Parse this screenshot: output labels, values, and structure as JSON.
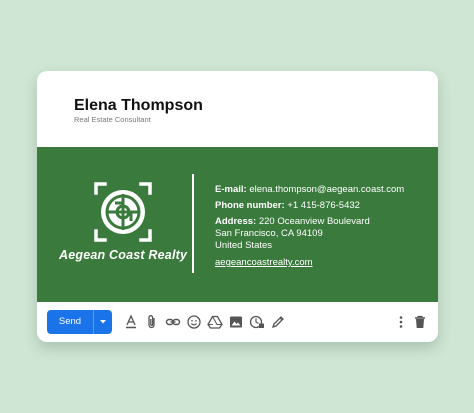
{
  "signature": {
    "name": "Elena Thompson",
    "title": "Real Estate Consultant"
  },
  "banner": {
    "company": "Aegean Coast Realty",
    "logo_icon": "building-monogram-logo",
    "accent_color": "#3a7a3c",
    "email_label": "E-mail:",
    "email_value": "elena.thompson@aegean.coast.com",
    "phone_label": "Phone number:",
    "phone_value": "+1 415-876-5432",
    "address_label": "Address:",
    "address_line1": "220 Oceanview Boulevard",
    "address_line2": "San Francisco, CA 94109",
    "address_line3": "United States",
    "website": "aegeancoastrealty.com"
  },
  "toolbar": {
    "send_label": "Send",
    "send_color": "#1a73e8",
    "icons": [
      "format-text-icon",
      "attach-icon",
      "link-icon",
      "emoji-icon",
      "drive-icon",
      "image-icon",
      "confidential-icon",
      "signature-pen-icon",
      "more-options-icon",
      "delete-icon"
    ]
  }
}
